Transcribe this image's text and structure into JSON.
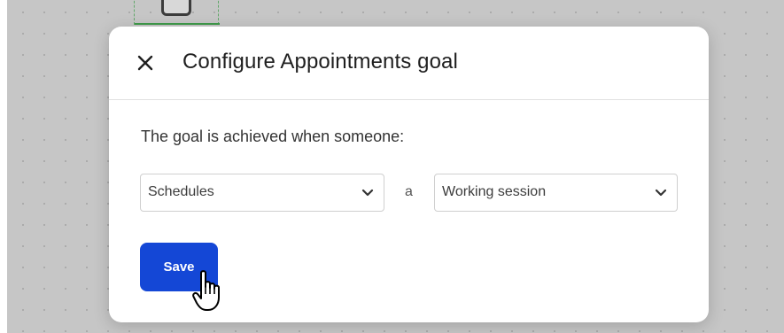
{
  "modal": {
    "title": "Configure Appointments goal",
    "close_icon": "close-icon"
  },
  "form": {
    "intro": "The goal is achieved when someone:",
    "action_select": {
      "value": "Schedules",
      "icon": "chevron-down-icon"
    },
    "connector": "a",
    "event_select": {
      "value": "Working session",
      "icon": "chevron-down-icon"
    },
    "save_label": "Save"
  },
  "cursor": {
    "icon": "hand-pointer-icon"
  },
  "colors": {
    "accent": "#1447d6",
    "backdrop": "#c6c6c6",
    "node_outline": "#3f9a4a"
  }
}
